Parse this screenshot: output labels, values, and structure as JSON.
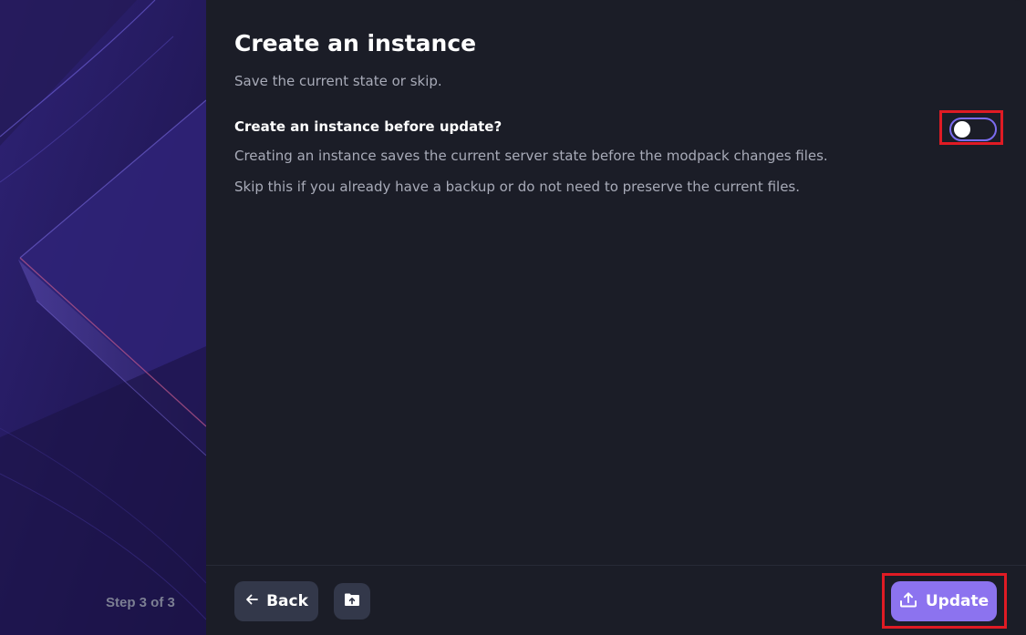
{
  "sidebar": {
    "step_label": "Step 3 of 3"
  },
  "main": {
    "title": "Create an instance",
    "subtitle": "Save the current state or skip.",
    "setting": {
      "label": "Create an instance before update?",
      "description_1": "Creating an instance saves the current server state before the modpack changes files.",
      "description_2": "Skip this if you already have a backup or do not need to preserve the current files.",
      "toggle_on": false
    }
  },
  "footer": {
    "back_label": "Back",
    "update_label": "Update"
  },
  "icons": {
    "back": "arrow-left-icon",
    "folder": "folder-upload-icon",
    "update": "upload-icon"
  },
  "colors": {
    "background": "#1b1d27",
    "accent": "#8c73ef",
    "toggle_border": "#7b6cf0",
    "secondary_button": "#33384a",
    "highlight": "#e01b24"
  }
}
